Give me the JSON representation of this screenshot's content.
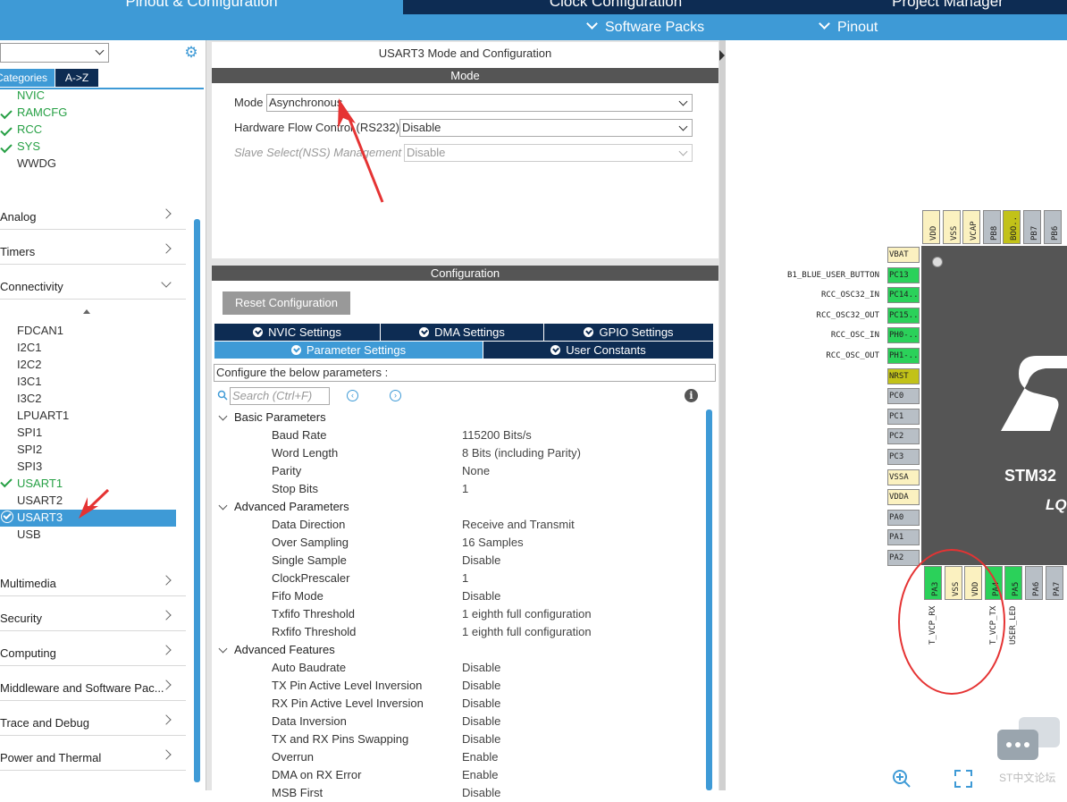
{
  "header": {
    "tabs": [
      "Pinout & Configuration",
      "Clock Configuration",
      "Project Manager"
    ],
    "subtabs": [
      "Software Packs",
      "Pinout"
    ]
  },
  "left": {
    "tab_categories": "Categories",
    "tab_az": "A->Z",
    "system_items": [
      {
        "label": "NVIC",
        "checked": false,
        "green": true
      },
      {
        "label": "RAMCFG",
        "checked": true,
        "green": true
      },
      {
        "label": "RCC",
        "checked": true,
        "green": true
      },
      {
        "label": "SYS",
        "checked": true,
        "green": true
      },
      {
        "label": "WWDG",
        "checked": false,
        "green": false
      }
    ],
    "categories_a": [
      "Analog",
      "Timers",
      "Connectivity"
    ],
    "connectivity_items": [
      {
        "label": "FDCAN1",
        "checked": false
      },
      {
        "label": "I2C1",
        "checked": false
      },
      {
        "label": "I2C2",
        "checked": false
      },
      {
        "label": "I3C1",
        "checked": false
      },
      {
        "label": "I3C2",
        "checked": false
      },
      {
        "label": "LPUART1",
        "checked": false
      },
      {
        "label": "SPI1",
        "checked": false
      },
      {
        "label": "SPI2",
        "checked": false
      },
      {
        "label": "SPI3",
        "checked": false
      },
      {
        "label": "USART1",
        "checked": true
      },
      {
        "label": "USART2",
        "checked": false
      },
      {
        "label": "USART3",
        "checked": true,
        "selected": true
      },
      {
        "label": "USB",
        "checked": false
      }
    ],
    "categories_b": [
      "Multimedia",
      "Security",
      "Computing",
      "Middleware and Software Pac...",
      "Trace and Debug",
      "Power and Thermal"
    ]
  },
  "mode": {
    "title": "USART3 Mode and Configuration",
    "header": "Mode",
    "mode_label": "Mode",
    "mode_value": "Asynchronous",
    "hwflow_label": "Hardware Flow Control (RS232)",
    "hwflow_value": "Disable",
    "nss_label": "Slave Select(NSS) Management",
    "nss_value": "Disable"
  },
  "config": {
    "header": "Configuration",
    "reset_label": "Reset Configuration",
    "tabs_row1": [
      "NVIC Settings",
      "DMA Settings",
      "GPIO Settings"
    ],
    "tabs_row2": [
      "Parameter Settings",
      "User Constants"
    ],
    "configure_text": "Configure the below parameters :",
    "search_placeholder": "Search (Ctrl+F)",
    "groups": [
      {
        "name": "Basic Parameters",
        "params": [
          [
            "Baud Rate",
            "115200 Bits/s"
          ],
          [
            "Word Length",
            "8 Bits (including Parity)"
          ],
          [
            "Parity",
            "None"
          ],
          [
            "Stop Bits",
            "1"
          ]
        ]
      },
      {
        "name": "Advanced Parameters",
        "params": [
          [
            "Data Direction",
            "Receive and Transmit"
          ],
          [
            "Over Sampling",
            "16 Samples"
          ],
          [
            "Single Sample",
            "Disable"
          ],
          [
            "ClockPrescaler",
            "1"
          ],
          [
            "Fifo Mode",
            "Disable"
          ],
          [
            "Txfifo Threshold",
            "1 eighth full configuration"
          ],
          [
            "Rxfifo Threshold",
            "1 eighth full configuration"
          ]
        ]
      },
      {
        "name": "Advanced Features",
        "params": [
          [
            "Auto Baudrate",
            "Disable"
          ],
          [
            "TX Pin Active Level Inversion",
            "Disable"
          ],
          [
            "RX Pin Active Level Inversion",
            "Disable"
          ],
          [
            "Data Inversion",
            "Disable"
          ],
          [
            "TX and RX Pins Swapping",
            "Disable"
          ],
          [
            "Overrun",
            "Enable"
          ],
          [
            "DMA on RX Error",
            "Enable"
          ],
          [
            "MSB First",
            "Disable"
          ]
        ]
      }
    ]
  },
  "chip": {
    "name": "STM32",
    "package": "LQ",
    "left_pins": [
      {
        "name": "VBAT",
        "color": "yellow",
        "signal": ""
      },
      {
        "name": "PC13",
        "color": "green",
        "signal": "B1_BLUE_USER_BUTTON"
      },
      {
        "name": "PC14..",
        "color": "green",
        "signal": "RCC_OSC32_IN"
      },
      {
        "name": "PC15..",
        "color": "green",
        "signal": "RCC_OSC32_OUT"
      },
      {
        "name": "PH0-..",
        "color": "green",
        "signal": "RCC_OSC_IN"
      },
      {
        "name": "PH1-..",
        "color": "green",
        "signal": "RCC_OSC_OUT"
      },
      {
        "name": "NRST",
        "color": "olive",
        "signal": ""
      },
      {
        "name": "PC0",
        "color": "gray",
        "signal": ""
      },
      {
        "name": "PC1",
        "color": "gray",
        "signal": ""
      },
      {
        "name": "PC2",
        "color": "gray",
        "signal": ""
      },
      {
        "name": "PC3",
        "color": "gray",
        "signal": ""
      },
      {
        "name": "VSSA",
        "color": "yellow",
        "signal": ""
      },
      {
        "name": "VDDA",
        "color": "yellow",
        "signal": ""
      },
      {
        "name": "PA0",
        "color": "gray",
        "signal": ""
      },
      {
        "name": "PA1",
        "color": "gray",
        "signal": ""
      },
      {
        "name": "PA2",
        "color": "gray",
        "signal": ""
      }
    ],
    "top_pins": [
      {
        "name": "VDD",
        "color": "yellow"
      },
      {
        "name": "VSS",
        "color": "yellow"
      },
      {
        "name": "VCAP",
        "color": "yellow"
      },
      {
        "name": "PB8",
        "color": "gray"
      },
      {
        "name": "BOO..",
        "color": "olive"
      },
      {
        "name": "PB7",
        "color": "gray"
      },
      {
        "name": "PB6",
        "color": "gray"
      }
    ],
    "bottom_pins": [
      {
        "name": "PA3",
        "color": "green",
        "signal": "T_VCP_RX"
      },
      {
        "name": "VSS",
        "color": "yellow",
        "signal": ""
      },
      {
        "name": "VDD",
        "color": "yellow",
        "signal": ""
      },
      {
        "name": "PA4",
        "color": "green",
        "signal": "T_VCP_TX"
      },
      {
        "name": "PA5",
        "color": "green",
        "signal": "USER_LED"
      },
      {
        "name": "PA6",
        "color": "gray",
        "signal": ""
      },
      {
        "name": "PA7",
        "color": "gray",
        "signal": ""
      }
    ]
  },
  "watermark": "ST中文论坛",
  "colors": {
    "accent": "#3e9ad6",
    "navy": "#0d2c53",
    "green": "#27a045",
    "annotation": "#e53333"
  }
}
